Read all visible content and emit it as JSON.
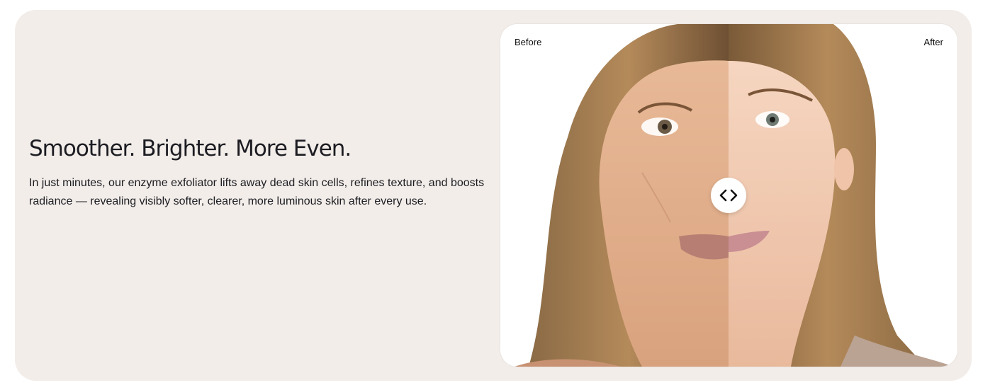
{
  "section": {
    "headline": "Smoother. Brighter. More Even.",
    "body": "In just minutes, our enzyme exfoliator lifts away dead skin cells, refines texture, and boosts radiance — revealing visibly softer, clearer, more luminous skin after every use."
  },
  "comparison": {
    "before_label": "Before",
    "after_label": "After",
    "slider_position": 0.5,
    "handle_icon": "chevrons-left-right-icon",
    "image_description_icon": "portrait-photo"
  },
  "colors": {
    "card_background": "#f2ede9",
    "text": "#1c1c22",
    "handle": "#ffffff"
  }
}
